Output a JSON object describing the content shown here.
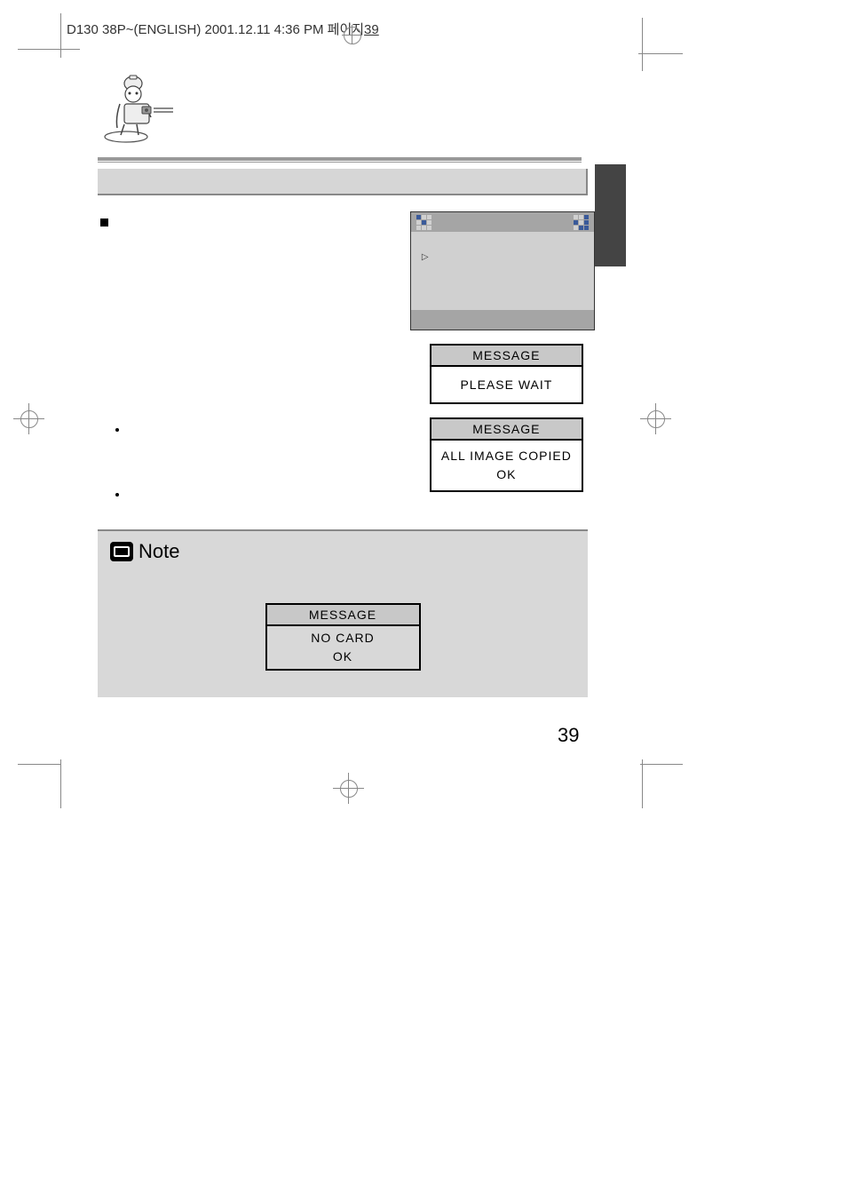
{
  "header": {
    "file_info": "D130 38P~(ENGLISH)  2001.12.11  4:36 PM  페이지",
    "page_ref": "39"
  },
  "menu": {
    "arrow": "▷"
  },
  "messages": {
    "label": "MESSAGE",
    "wait": "PLEASE WAIT",
    "copied_line1": "ALL IMAGE COPIED",
    "copied_line2": "OK",
    "nocard_line1": "NO CARD",
    "nocard_line2": "OK"
  },
  "note": {
    "label": "Note"
  },
  "page_number": "39"
}
